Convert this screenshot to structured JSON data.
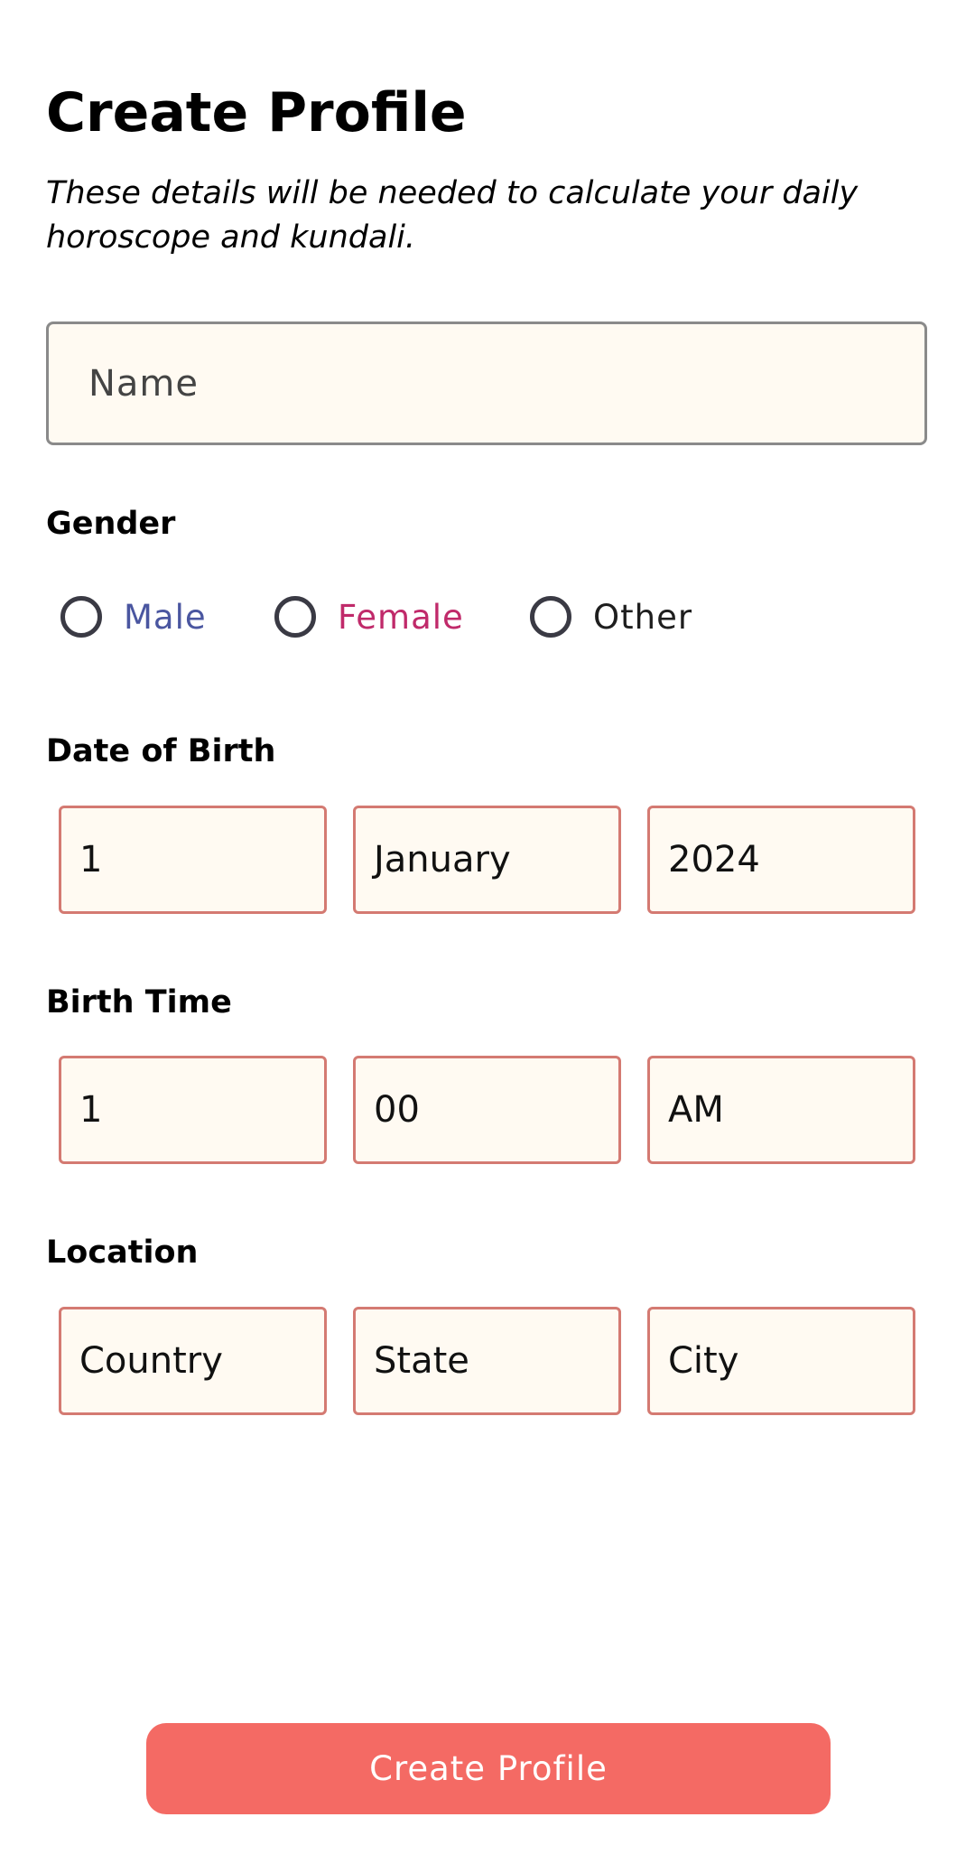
{
  "header": {
    "title": "Create Profile",
    "subtitle": "These details will be needed to calculate your daily horoscope and kundali."
  },
  "name_field": {
    "placeholder": "Name",
    "value": ""
  },
  "gender": {
    "label": "Gender",
    "options": [
      {
        "label": "Male",
        "color": "#4a56a0",
        "selected": false
      },
      {
        "label": "Female",
        "color": "#c02a6a",
        "selected": false
      },
      {
        "label": "Other",
        "color": "#1e1e1e",
        "selected": false
      }
    ]
  },
  "date_of_birth": {
    "label": "Date of Birth",
    "day": "1",
    "month": "January",
    "year": "2024"
  },
  "birth_time": {
    "label": "Birth Time",
    "hour": "1",
    "minute": "00",
    "period": "AM"
  },
  "location": {
    "label": "Location",
    "country": "Country",
    "state": "State",
    "city": "City"
  },
  "submit": {
    "label": "Create Profile",
    "color": "#f46a64"
  }
}
